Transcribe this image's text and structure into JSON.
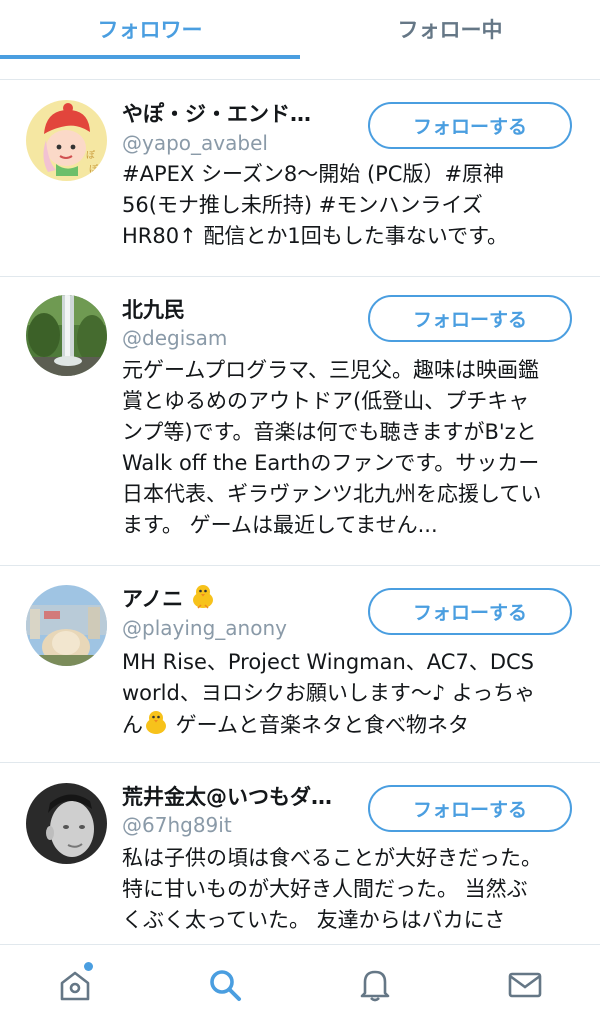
{
  "tabs": {
    "followers": "フォロワー",
    "following": "フォロー中"
  },
  "follow_label": "フォローする",
  "users": [
    {
      "name": "やぽ・ジ・エンド…",
      "handle": "@yapo_avabel",
      "bio_lines": [
        "#APEX シーズン8〜開始 (PC版）#原神",
        "56(モナ推し未所持) #モンハンライズ",
        "HR80↑ 配信とか1回もした事ないです。"
      ]
    },
    {
      "name": "北九民",
      "handle": "@degisam",
      "bio_lines": [
        "元ゲームプログラマ、三児父。趣味は映画鑑",
        "賞とゆるめのアウトドア(低登山、プチキャ",
        "ンプ等)です。音楽は何でも聴きますがB'zと",
        "Walk off the Earthのファンです。サッカー",
        "日本代表、ギラヴァンツ北九州を応援してい",
        "ます。 ゲームは最近してません..."
      ]
    },
    {
      "name": "アノニ",
      "handle": "@playing_anony",
      "bio_lines": [
        "MH Rise、Project Wingman、AC7、DCS",
        "world、ヨロシクお願いします〜♪ よっちゃ",
        "ん ゲームと音楽ネタと食べ物ネタ"
      ]
    },
    {
      "name": "荒井金太@いつもダ…",
      "handle": "@67hg89it",
      "bio_lines": [
        "私は子供の頃は食べることが大好きだった。",
        "特に甘いものが大好き人間だった。 当然ぶ",
        "くぶく太っていた。 友達からはバカにさ"
      ]
    }
  ],
  "nav": [
    "home-icon",
    "search-icon",
    "bell-icon",
    "mail-icon"
  ],
  "colors": {
    "accent": "#4a9ee0",
    "text": "#14171a",
    "muted": "#8a9aa8",
    "border": "#e1e8ed"
  }
}
